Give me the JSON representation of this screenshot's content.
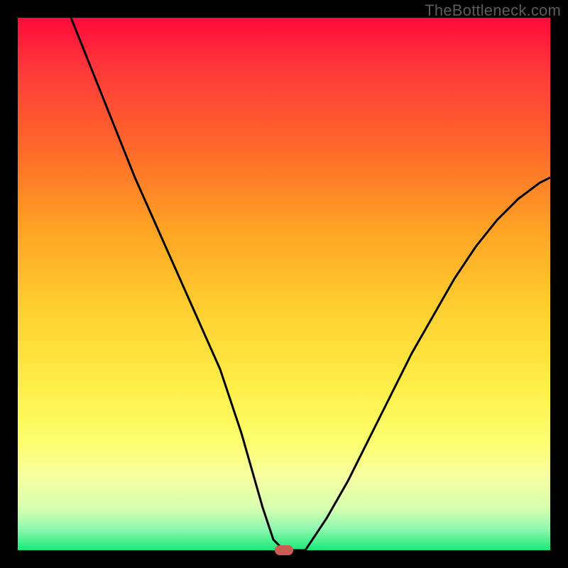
{
  "watermark": "TheBottleneck.com",
  "colors": {
    "frame": "#000000",
    "curve": "#000000",
    "marker": "#cc5b52",
    "watermark": "#5c5c5c"
  },
  "chart_data": {
    "type": "line",
    "title": "",
    "xlabel": "",
    "ylabel": "",
    "xlim": [
      0,
      100
    ],
    "ylim": [
      0,
      100
    ],
    "grid": false,
    "series": [
      {
        "name": "bottleneck-curve",
        "x": [
          10,
          14,
          18,
          22,
          26,
          30,
          34,
          38,
          42,
          44,
          46,
          48,
          50,
          54,
          58,
          62,
          66,
          70,
          74,
          78,
          82,
          86,
          90,
          94,
          98,
          100
        ],
        "values": [
          100,
          90,
          80,
          70,
          61,
          52,
          43,
          34,
          22,
          15,
          8,
          2,
          0,
          0,
          6,
          13,
          21,
          29,
          37,
          44,
          51,
          57,
          62,
          66,
          69,
          70
        ]
      }
    ],
    "marker": {
      "x": 50,
      "y": 0
    },
    "gradient_stops": [
      {
        "pct": 0,
        "color": "#ff0a3a"
      },
      {
        "pct": 10,
        "color": "#ff3a3a"
      },
      {
        "pct": 25,
        "color": "#ff6a2a"
      },
      {
        "pct": 40,
        "color": "#ffa424"
      },
      {
        "pct": 55,
        "color": "#ffd030"
      },
      {
        "pct": 70,
        "color": "#fff04a"
      },
      {
        "pct": 80,
        "color": "#fcff70"
      },
      {
        "pct": 86,
        "color": "#f8ffa0"
      },
      {
        "pct": 92,
        "color": "#d8ffb0"
      },
      {
        "pct": 96,
        "color": "#90f7b0"
      },
      {
        "pct": 100,
        "color": "#18e975"
      }
    ]
  }
}
